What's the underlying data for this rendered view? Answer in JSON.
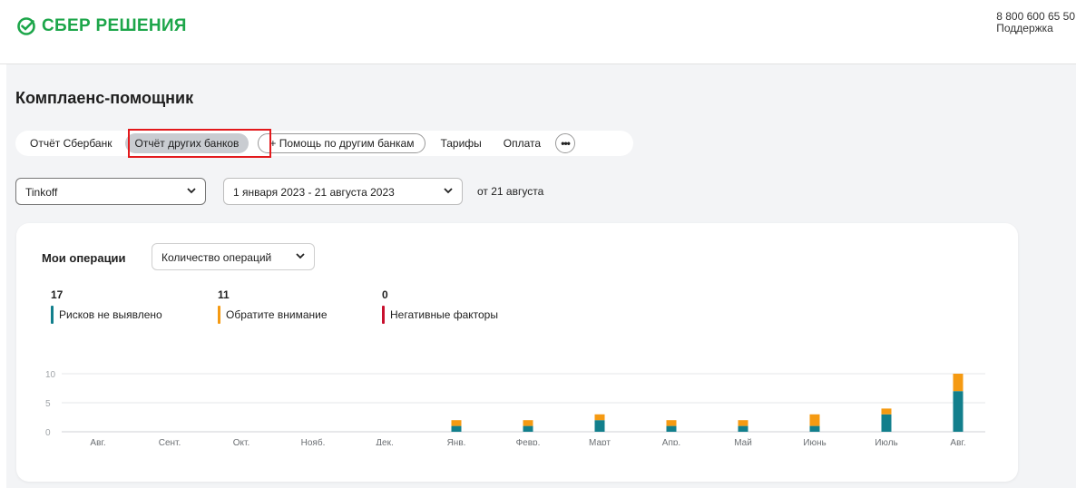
{
  "brand": {
    "name": "СБЕР РЕШЕНИЯ",
    "color": "#1da64a"
  },
  "header": {
    "phone": "8 800 600 65 50",
    "support": "Поддержка"
  },
  "page": {
    "title": "Комплаенс-помощник"
  },
  "tabs": {
    "items": [
      "Отчёт Сбербанк",
      "Отчёт других банков",
      "+ Помощь по другим банкам",
      "Тарифы",
      "Оплата"
    ],
    "active": "Отчёт других банков",
    "more_icon": "more-dots-icon"
  },
  "filters": {
    "bank": "Tinkoff",
    "period": "1 января 2023 - 21 августа 2023",
    "as_of": "от 21 августа"
  },
  "operations": {
    "title": "Мои операции",
    "metric_select": "Количество операций",
    "metrics": [
      {
        "value": "17",
        "label": "Рисков не выявлено",
        "color": "#127f8c"
      },
      {
        "value": "11",
        "label": "Обратите внимание",
        "color": "#f59a12"
      },
      {
        "value": "0",
        "label": "Негативные факторы",
        "color": "#c8102e"
      }
    ]
  },
  "chart_data": {
    "type": "bar",
    "stacked": true,
    "categories": [
      "Авг.",
      "Сент.",
      "Окт.",
      "Нояб.",
      "Дек.",
      "Янв.",
      "Февр.",
      "Март",
      "Апр.",
      "Май",
      "Июнь",
      "Июль",
      "Авг."
    ],
    "series": [
      {
        "name": "Рисков не выявлено",
        "color": "#127f8c",
        "values": [
          0,
          0,
          0,
          0,
          0,
          1,
          1,
          2,
          1,
          1,
          1,
          3,
          7
        ]
      },
      {
        "name": "Обратите внимание",
        "color": "#f59a12",
        "values": [
          0,
          0,
          0,
          0,
          0,
          1,
          1,
          1,
          1,
          1,
          2,
          1,
          3
        ]
      },
      {
        "name": "Негативные факторы",
        "color": "#c8102e",
        "values": [
          0,
          0,
          0,
          0,
          0,
          0,
          0,
          0,
          0,
          0,
          0,
          0,
          0
        ]
      }
    ],
    "yticks": [
      0,
      5,
      10
    ],
    "ylim": [
      0,
      10
    ],
    "grid": true,
    "xlabel": "",
    "ylabel": ""
  }
}
